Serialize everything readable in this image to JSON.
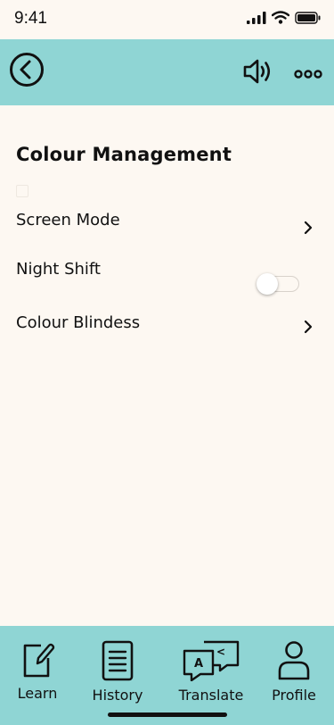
{
  "status_bar": {
    "time": "9:41"
  },
  "header": {
    "back_icon": "chevron-left-circle-icon",
    "sound_icon": "speaker-icon",
    "more_icon": "more-horizontal-icon"
  },
  "page": {
    "title": "Colour Management"
  },
  "settings": {
    "screen_mode": {
      "label": "Screen Mode",
      "icon": "chevron-right-icon"
    },
    "night_shift": {
      "label": "Night Shift",
      "enabled": false
    },
    "colour_blindness": {
      "label": "Colour Blindess",
      "icon": "chevron-right-icon"
    }
  },
  "tab_bar": {
    "learn": {
      "label": "Learn",
      "icon": "edit-icon"
    },
    "history": {
      "label": "History",
      "icon": "document-icon"
    },
    "translate": {
      "label": "Translate",
      "icon": "translate-icon"
    },
    "profile": {
      "label": "Profile",
      "icon": "user-icon"
    }
  },
  "colors": {
    "accent": "#8fd5d4",
    "background": "#fdf8f2",
    "text": "#111111"
  }
}
